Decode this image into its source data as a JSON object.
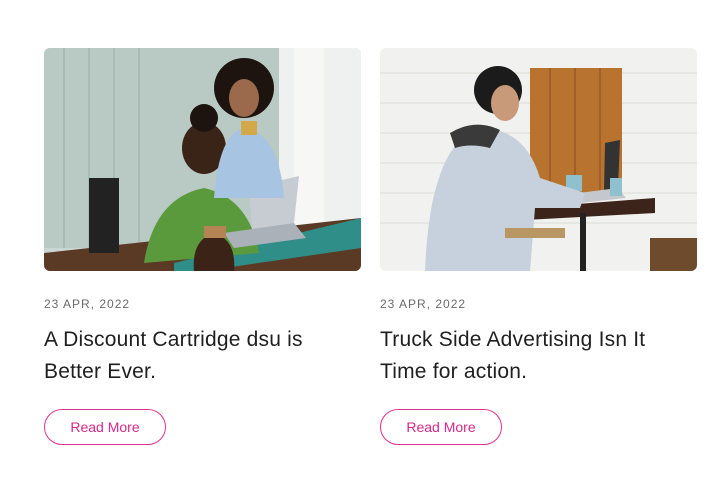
{
  "posts": [
    {
      "date": "23 APR, 2022",
      "title": "A Discount Cartridge dsu is Better Ever.",
      "button_label": "Read More"
    },
    {
      "date": "23 APR, 2022",
      "title": "Truck Side Advertising Isn It Time for action.",
      "button_label": "Read More"
    }
  ],
  "colors": {
    "accent": "#e0338f",
    "title_text": "#1f1f1f",
    "date_text": "#6b6b6b"
  }
}
